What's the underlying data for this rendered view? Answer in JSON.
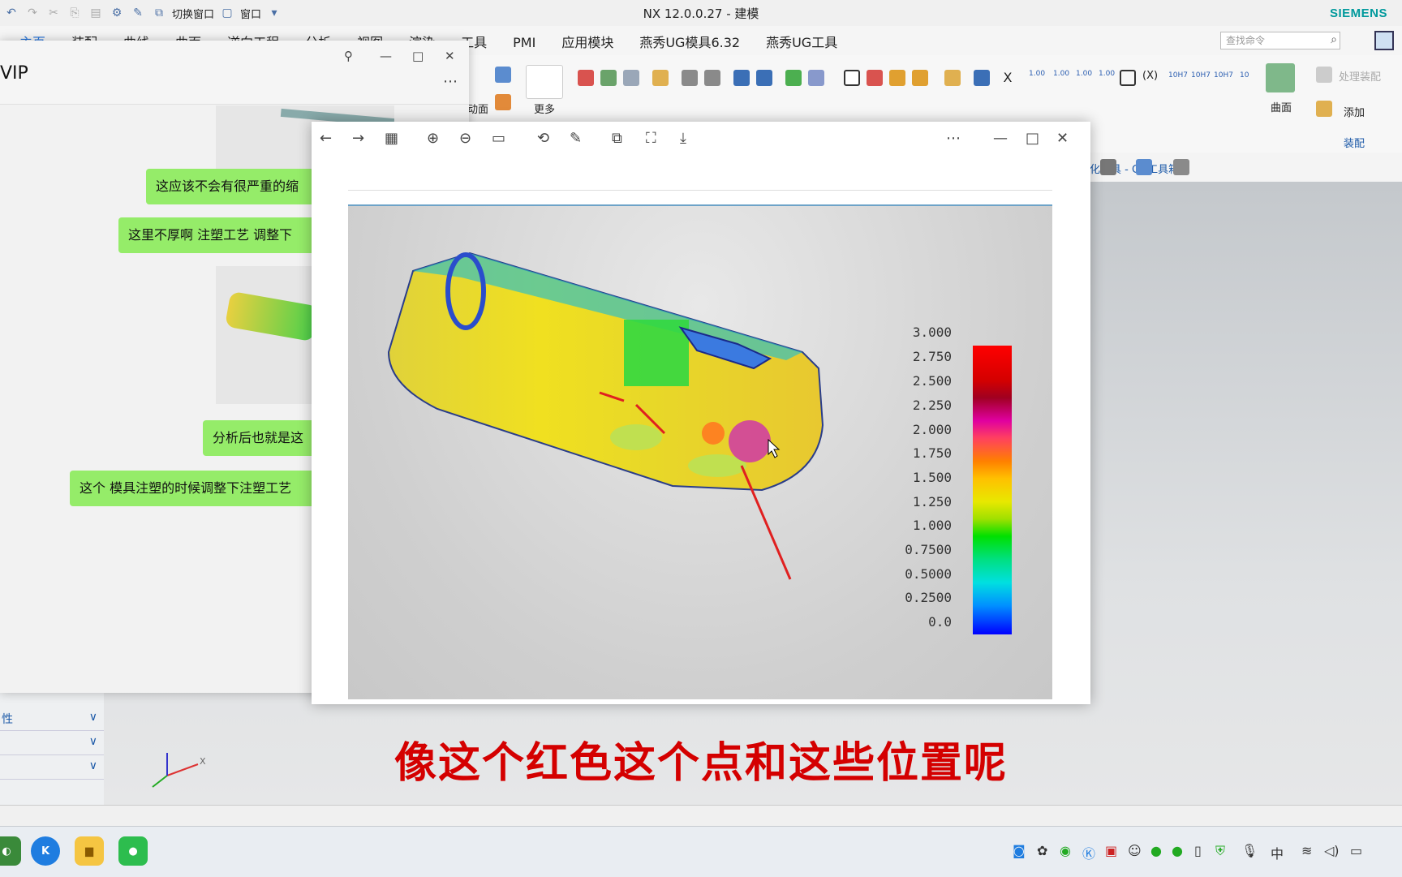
{
  "nx": {
    "title": "NX 12.0.0.27 - 建模",
    "brand": "SIEMENS",
    "quick_access": {
      "switch_window": "切换窗口",
      "window": "窗口"
    },
    "tabs": [
      "主页",
      "装配",
      "曲线",
      "曲面",
      "逆向工程",
      "分析",
      "视图",
      "渲染",
      "工具",
      "PMI",
      "应用模块",
      "燕秀UG模具6.32",
      "燕秀UG工具"
    ],
    "active_tab": "主页",
    "search_placeholder": "查找命令",
    "ribbon": {
      "more": "更多",
      "side_label": "动面",
      "surface": "曲面",
      "add": "添加",
      "assembly": "装配",
      "process_assembly": "处理装配",
      "gc_toolbox": "化工具 - GC工具箱",
      "dim_labels": [
        "1.00",
        "1.00",
        "1.00",
        "1.00",
        "10H7",
        "10H7",
        "10H7",
        "10"
      ]
    },
    "left_panel": {
      "prop_label": "性"
    },
    "triad_axis": "X"
  },
  "chat": {
    "title": "VIP",
    "messages": [
      "这应该不会有很严重的缩",
      "这里不厚啊  注塑工艺 调整下",
      "分析后也就是这",
      "这个 模具注塑的时候调整下注塑工艺"
    ]
  },
  "legend": {
    "ticks": [
      "3.000",
      "2.750",
      "2.500",
      "2.250",
      "2.000",
      "1.750",
      "1.500",
      "1.250",
      "1.000",
      "0.7500",
      "0.5000",
      "0.2500",
      "0.0"
    ]
  },
  "subtitle": "像这个红色这个点和这些位置呢",
  "colors": {
    "accent": "#1f6fd8",
    "bubble": "#95ec69",
    "subtitle": "#d40000",
    "brand": "#00999c"
  }
}
